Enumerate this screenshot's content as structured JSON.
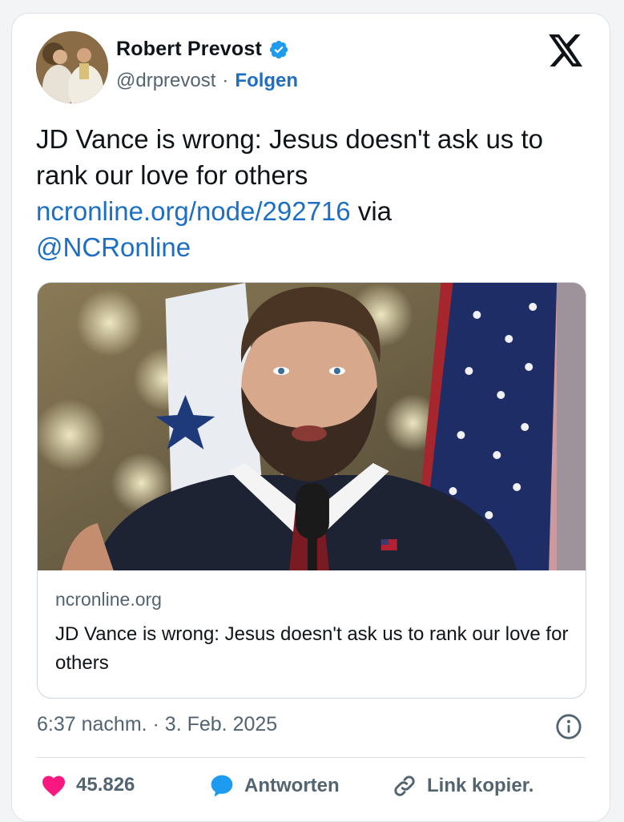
{
  "colors": {
    "accent": "#1d6fc4",
    "verified": "#1d9bf0",
    "like": "#f91880",
    "reply": "#1d9bf0"
  },
  "author": {
    "name": "Robert Prevost",
    "handle": "@drprevost",
    "separator": "·",
    "follow_label": "Folgen"
  },
  "tweet": {
    "text": "JD Vance is wrong: Jesus doesn't ask us to rank our love for others",
    "link": "ncronline.org/node/292716",
    "via": "via",
    "mention": "@NCRonline"
  },
  "card": {
    "domain": "ncronline.org",
    "title": "JD Vance is wrong: Jesus doesn't ask us to rank our love for others"
  },
  "timestamp": "6:37 nachm. · 3. Feb. 2025",
  "actions": {
    "likes": "45.826",
    "reply_label": "Antworten",
    "copy_link_label": "Link kopier."
  }
}
